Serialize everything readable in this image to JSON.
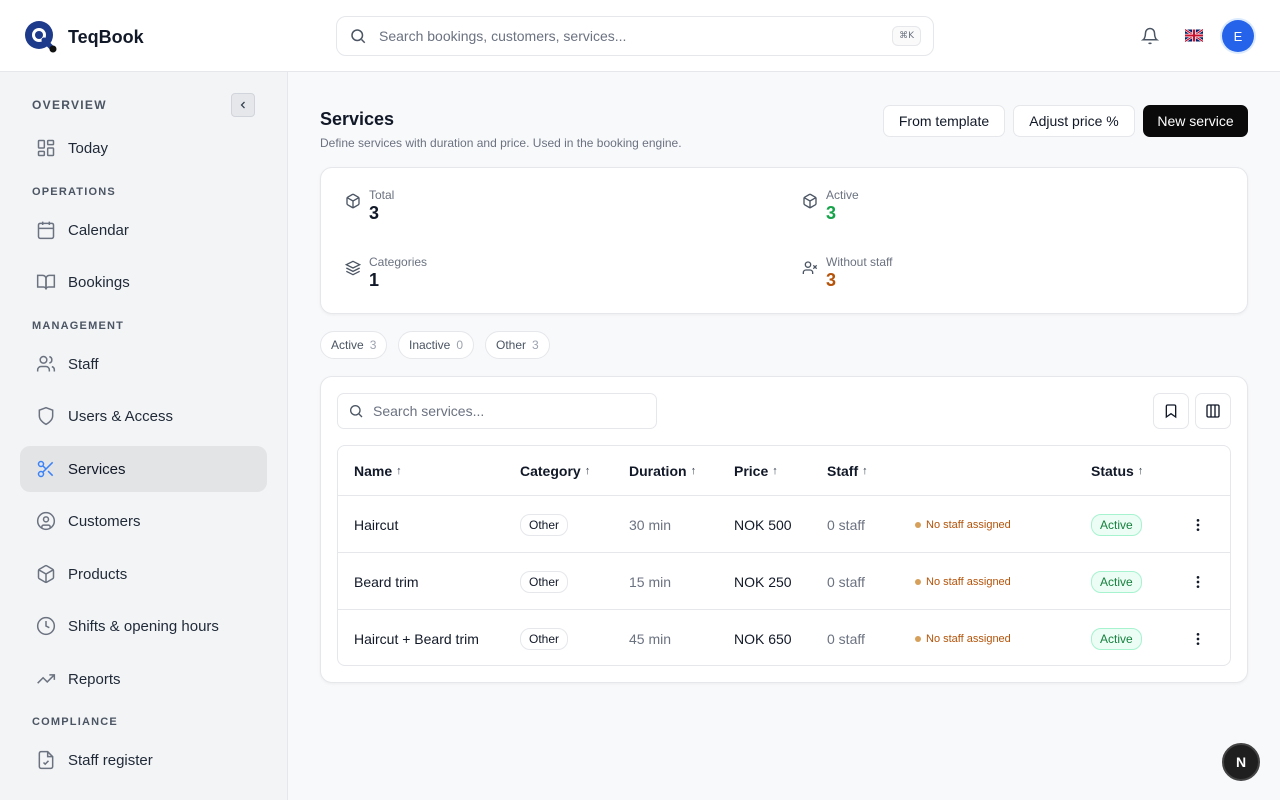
{
  "app": {
    "name": "TeqBook"
  },
  "header": {
    "search_placeholder": "Search bookings, customers, services...",
    "search_shortcut": "⌘K",
    "avatar_initial": "E"
  },
  "sidebar": {
    "overview_label": "OVERVIEW",
    "operations_label": "OPERATIONS",
    "management_label": "MANAGEMENT",
    "compliance_label": "COMPLIANCE",
    "items": [
      {
        "label": "Today",
        "icon": "layout-grid-icon"
      },
      {
        "label": "Calendar",
        "icon": "calendar-icon"
      },
      {
        "label": "Bookings",
        "icon": "book-open-icon"
      },
      {
        "label": "Staff",
        "icon": "users-icon"
      },
      {
        "label": "Users & Access",
        "icon": "shield-icon"
      },
      {
        "label": "Services",
        "icon": "scissors-icon",
        "active": true
      },
      {
        "label": "Customers",
        "icon": "user-circle-icon"
      },
      {
        "label": "Products",
        "icon": "package-icon"
      },
      {
        "label": "Shifts & opening hours",
        "icon": "clock-icon"
      },
      {
        "label": "Reports",
        "icon": "trending-up-icon"
      },
      {
        "label": "Staff register",
        "icon": "file-check-icon"
      }
    ]
  },
  "page": {
    "title": "Services",
    "subtitle": "Define services with duration and price. Used in the booking engine.",
    "buttons": {
      "from_template": "From template",
      "adjust_price": "Adjust price %",
      "new_service": "New service"
    }
  },
  "stats": {
    "total_label": "Total",
    "total_value": "3",
    "active_label": "Active",
    "active_value": "3",
    "categories_label": "Categories",
    "categories_value": "1",
    "without_staff_label": "Without staff",
    "without_staff_value": "3",
    "colors": {
      "active": "#16a34a",
      "without_staff": "#b45309"
    }
  },
  "filters": [
    {
      "label": "Active",
      "count": "3"
    },
    {
      "label": "Inactive",
      "count": "0"
    },
    {
      "label": "Other",
      "count": "3"
    }
  ],
  "table": {
    "search_placeholder": "Search services...",
    "headers": {
      "name": "Name",
      "category": "Category",
      "duration": "Duration",
      "price": "Price",
      "staff": "Staff",
      "status": "Status",
      "sort_arrow": "↑"
    },
    "rows": [
      {
        "name": "Haircut",
        "category": "Other",
        "duration": "30 min",
        "price": "NOK 500",
        "staff": "0 staff",
        "warning": "No staff assigned",
        "status": "Active"
      },
      {
        "name": "Beard trim",
        "category": "Other",
        "duration": "15 min",
        "price": "NOK 250",
        "staff": "0 staff",
        "warning": "No staff assigned",
        "status": "Active"
      },
      {
        "name": "Haircut + Beard trim",
        "category": "Other",
        "duration": "45 min",
        "price": "NOK 650",
        "staff": "0 staff",
        "warning": "No staff assigned",
        "status": "Active"
      }
    ]
  },
  "floating": {
    "label": "N"
  }
}
